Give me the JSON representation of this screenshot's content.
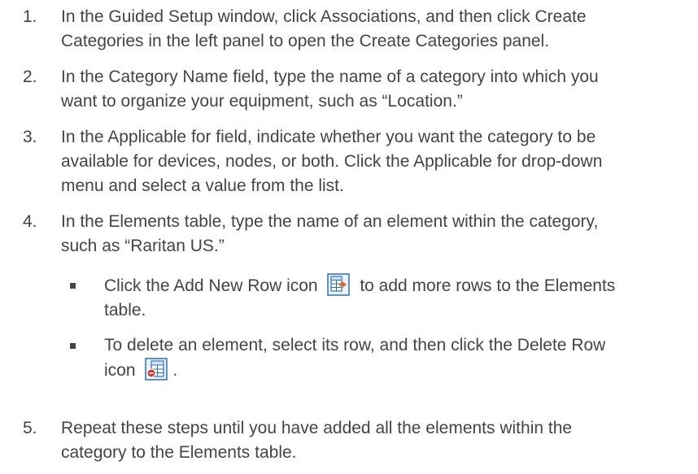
{
  "steps": [
    {
      "number": "1.",
      "lines": [
        "In the Guided Setup window, click Associations, and then click Create",
        "Categories in the left panel to open the Create Categories panel."
      ]
    },
    {
      "number": "2.",
      "lines": [
        "In the Category Name field, type the name of a category into which you",
        "want to organize your equipment, such as “Location.”"
      ]
    },
    {
      "number": "3.",
      "lines": [
        "In the Applicable for field, indicate whether you want the category to be",
        "available for devices, nodes, or both. Click the Applicable for drop-down",
        "menu and select a value from the list."
      ]
    },
    {
      "number": "4.",
      "lines": [
        "In the Elements table, type the name of an element within the category,",
        "such as “Raritan US.”"
      ]
    },
    {
      "number": "5.",
      "lines": [
        "Repeat these steps until you have added all the elements within the",
        "category to the Elements table."
      ]
    }
  ],
  "bullets": [
    {
      "before": "Click the Add New Row icon",
      "after": "to add more rows to the Elements",
      "line2": "table.",
      "icon": "add-new-row-icon"
    },
    {
      "line1": "To delete an element, select its row, and then click the Delete Row",
      "before": "icon",
      "after": ".",
      "icon": "delete-row-icon"
    }
  ],
  "colors": {
    "text": "#444444",
    "icon_border": "#2f6fb0",
    "icon_fill": "#cfe3f7",
    "icon_arrow": "#e06a2a",
    "icon_delete": "#d23a3a"
  }
}
